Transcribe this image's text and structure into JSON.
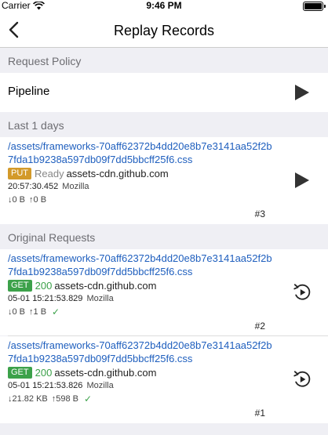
{
  "status_bar": {
    "carrier": "Carrier",
    "time": "9:46 PM"
  },
  "nav": {
    "title": "Replay Records"
  },
  "sections": {
    "policy_header": "Request Policy",
    "recent_header": "Last 1 days",
    "original_header": "Original Requests"
  },
  "policy": {
    "label": "Pipeline"
  },
  "replay": [
    {
      "url": "/assets/frameworks-70aff62372b4dd20e8b7e3141aa52f2b7fda1b9238a597db09f7dd5bbcff25f6.css",
      "method": "PUT",
      "status": "Ready",
      "host": "assets-cdn.github.com",
      "time": "20:57:30.452",
      "agent": "Mozilla",
      "down": "↓0 B",
      "up": "↑0 B",
      "index": "#3"
    }
  ],
  "originals": [
    {
      "url": "/assets/frameworks-70aff62372b4dd20e8b7e3141aa52f2b7fda1b9238a597db09f7dd5bbcff25f6.css",
      "method": "GET",
      "status": "200",
      "host": "assets-cdn.github.com",
      "time": "05-01 15:21:53.829",
      "agent": "Mozilla",
      "down": "↓0 B",
      "up": "↑1 B",
      "index": "#2"
    },
    {
      "url": "/assets/frameworks-70aff62372b4dd20e8b7e3141aa52f2b7fda1b9238a597db09f7dd5bbcff25f6.css",
      "method": "GET",
      "status": "200",
      "host": "assets-cdn.github.com",
      "time": "05-01 15:21:53.826",
      "agent": "Mozilla",
      "down": "↓21.82 KB",
      "up": "↑598 B",
      "index": "#1"
    }
  ],
  "colors": {
    "link": "#1f5fbe",
    "put": "#d39a2a",
    "get": "#3ca14a"
  },
  "icons": {
    "back": "chevron-left-icon",
    "play": "play-icon",
    "replay": "replay-icon",
    "success": "checkmark-icon",
    "wifi": "wifi-icon",
    "battery": "battery-icon"
  }
}
